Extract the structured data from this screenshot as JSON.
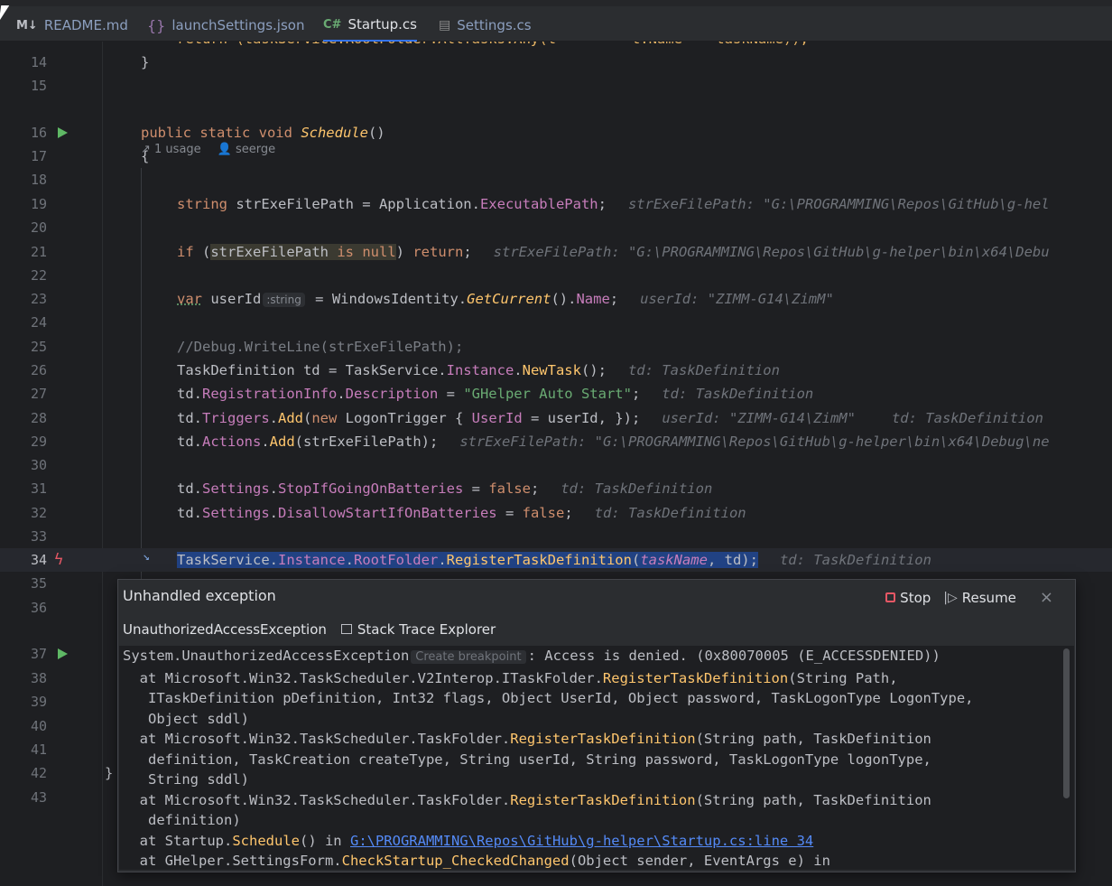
{
  "tabs": [
    {
      "icon": "M↓",
      "label": "README.md"
    },
    {
      "icon": "{}",
      "label": "launchSettings.json"
    },
    {
      "icon": "C#",
      "label": "Startup.cs",
      "active": true
    },
    {
      "icon": "▤",
      "label": "Settings.cs"
    }
  ],
  "editor": {
    "line_numbers": [
      "14",
      "15",
      "16",
      "17",
      "18",
      "19",
      "20",
      "21",
      "22",
      "23",
      "24",
      "25",
      "26",
      "27",
      "28",
      "29",
      "30",
      "31",
      "32",
      "33",
      "34",
      "35",
      "36",
      "37",
      "38",
      "39",
      "40",
      "41",
      "42",
      "43"
    ],
    "usages": {
      "count": "1 usage",
      "author": "seerge"
    },
    "lines": {
      "l14": "}",
      "l16_kw": "public static void ",
      "l16_name": "Schedule",
      "l16_end": "()",
      "l17": "{",
      "l19_type": "string",
      "l19_a": " strExeFilePath = Application.",
      "l19_prop": "ExecutablePath",
      "l19_b": ";",
      "l19_hint": "strExeFilePath: \"G:\\PROGRAMMING\\Repos\\GitHub\\g-hel",
      "l21_kw": "if",
      "l21_a": " (",
      "l21_var": "strExeFilePath ",
      "l21_is": "is null",
      "l21_b": ") ",
      "l21_ret": "return",
      "l21_c": ";",
      "l21_hint": "strExeFilePath: \"G:\\PROGRAMMING\\Repos\\GitHub\\g-helper\\bin\\x64\\Debu",
      "l23_kw": "var",
      "l23_a": " userId",
      "l23_inlay": ":string",
      "l23_b": " = WindowsIdentity.",
      "l23_m": "GetCurrent",
      "l23_c": "().",
      "l23_prop": "Name",
      "l23_d": ";",
      "l23_hint": "userId: \"ZIMM-G14\\ZimM\"",
      "l25": "//Debug.WriteLine(strExeFilePath);",
      "l26_a": "TaskDefinition td = TaskService.",
      "l26_p": "Instance",
      "l26_b": ".",
      "l26_m": "NewTask",
      "l26_c": "();",
      "l26_hint": "td: TaskDefinition",
      "l27_a": "td.",
      "l27_p1": "RegistrationInfo",
      "l27_b": ".",
      "l27_p2": "Description",
      "l27_c": " = ",
      "l27_s": "\"GHelper Auto Start\"",
      "l27_d": ";",
      "l27_hint": "td: TaskDefinition",
      "l28_a": "td.",
      "l28_p": "Triggers",
      "l28_b": ".",
      "l28_m": "Add",
      "l28_c": "(",
      "l28_new": "new",
      "l28_d": " LogonTrigger { ",
      "l28_p2": "UserId",
      "l28_e": " = userId, });",
      "l28_hint1": "userId: \"ZIMM-G14\\ZimM\"",
      "l28_hint2": "td: TaskDefinition",
      "l29_a": "td.",
      "l29_p": "Actions",
      "l29_b": ".",
      "l29_m": "Add",
      "l29_c": "(strExeFilePath);",
      "l29_hint": "strExeFilePath: \"G:\\PROGRAMMING\\Repos\\GitHub\\g-helper\\bin\\x64\\Debug\\ne",
      "l31_a": "td.",
      "l31_p1": "Settings",
      "l31_b": ".",
      "l31_p2": "StopIfGoingOnBatteries",
      "l31_c": " = ",
      "l31_f": "false",
      "l31_d": ";",
      "l31_hint": "td: TaskDefinition",
      "l32_a": "td.",
      "l32_p1": "Settings",
      "l32_b": ".",
      "l32_p2": "DisallowStartIfOnBatteries",
      "l32_c": " = ",
      "l32_f": "false",
      "l32_d": ";",
      "l32_hint": "td: TaskDefinition",
      "l34_a": "TaskService.",
      "l34_p1": "Instance",
      "l34_b": ".",
      "l34_p2": "RootFolder",
      "l34_c": ".",
      "l34_m": "RegisterTaskDefinition",
      "l34_d": "(",
      "l34_param": "taskName",
      "l34_e": ", td);",
      "l34_hint": "td: TaskDefinition",
      "l42": "}"
    }
  },
  "exception_popup": {
    "title": "Unhandled exception",
    "stop_label": "Stop",
    "resume_label": "Resume",
    "close_symbol": "×",
    "exception_type": "UnauthorizedAccessException",
    "stack_trace_explorer_label": "Stack Trace Explorer",
    "trace": {
      "t1_a": "System.UnauthorizedAccessException",
      "t1_bp": "Create breakpoint",
      "t1_b": ": Access is denied. (0x80070005 (E_ACCESSDENIED))",
      "t2_a": "  at Microsoft.Win32.TaskScheduler.V2Interop.ITaskFolder.",
      "t2_m": "RegisterTaskDefinition",
      "t2_b": "(String Path,",
      "t3": "   ITaskDefinition pDefinition, Int32 flags, Object UserId, Object password, TaskLogonType LogonType,",
      "t4": "   Object sddl)",
      "t5_a": "  at Microsoft.Win32.TaskScheduler.TaskFolder.",
      "t5_m": "RegisterTaskDefinition",
      "t5_b": "(String path, TaskDefinition",
      "t6": "   definition, TaskCreation createType, String userId, String password, TaskLogonType logonType,",
      "t7": "   String sddl)",
      "t8_a": "  at Microsoft.Win32.TaskScheduler.TaskFolder.",
      "t8_m": "RegisterTaskDefinition",
      "t8_b": "(String path, TaskDefinition",
      "t9": "   definition)",
      "t10_a": "  at Startup.",
      "t10_m": "Schedule",
      "t10_b": "() in ",
      "t10_link": "G:\\PROGRAMMING\\Repos\\GitHub\\g-helper\\Startup.cs:line 34",
      "t11_a": "  at GHelper.SettingsForm.",
      "t11_m": "CheckStartup_CheckedChanged",
      "t11_b": "(Object sender, EventArgs e) in"
    }
  },
  "colors": {
    "accent": "#3574f0",
    "error": "#e55765",
    "run": "#5fb865"
  }
}
